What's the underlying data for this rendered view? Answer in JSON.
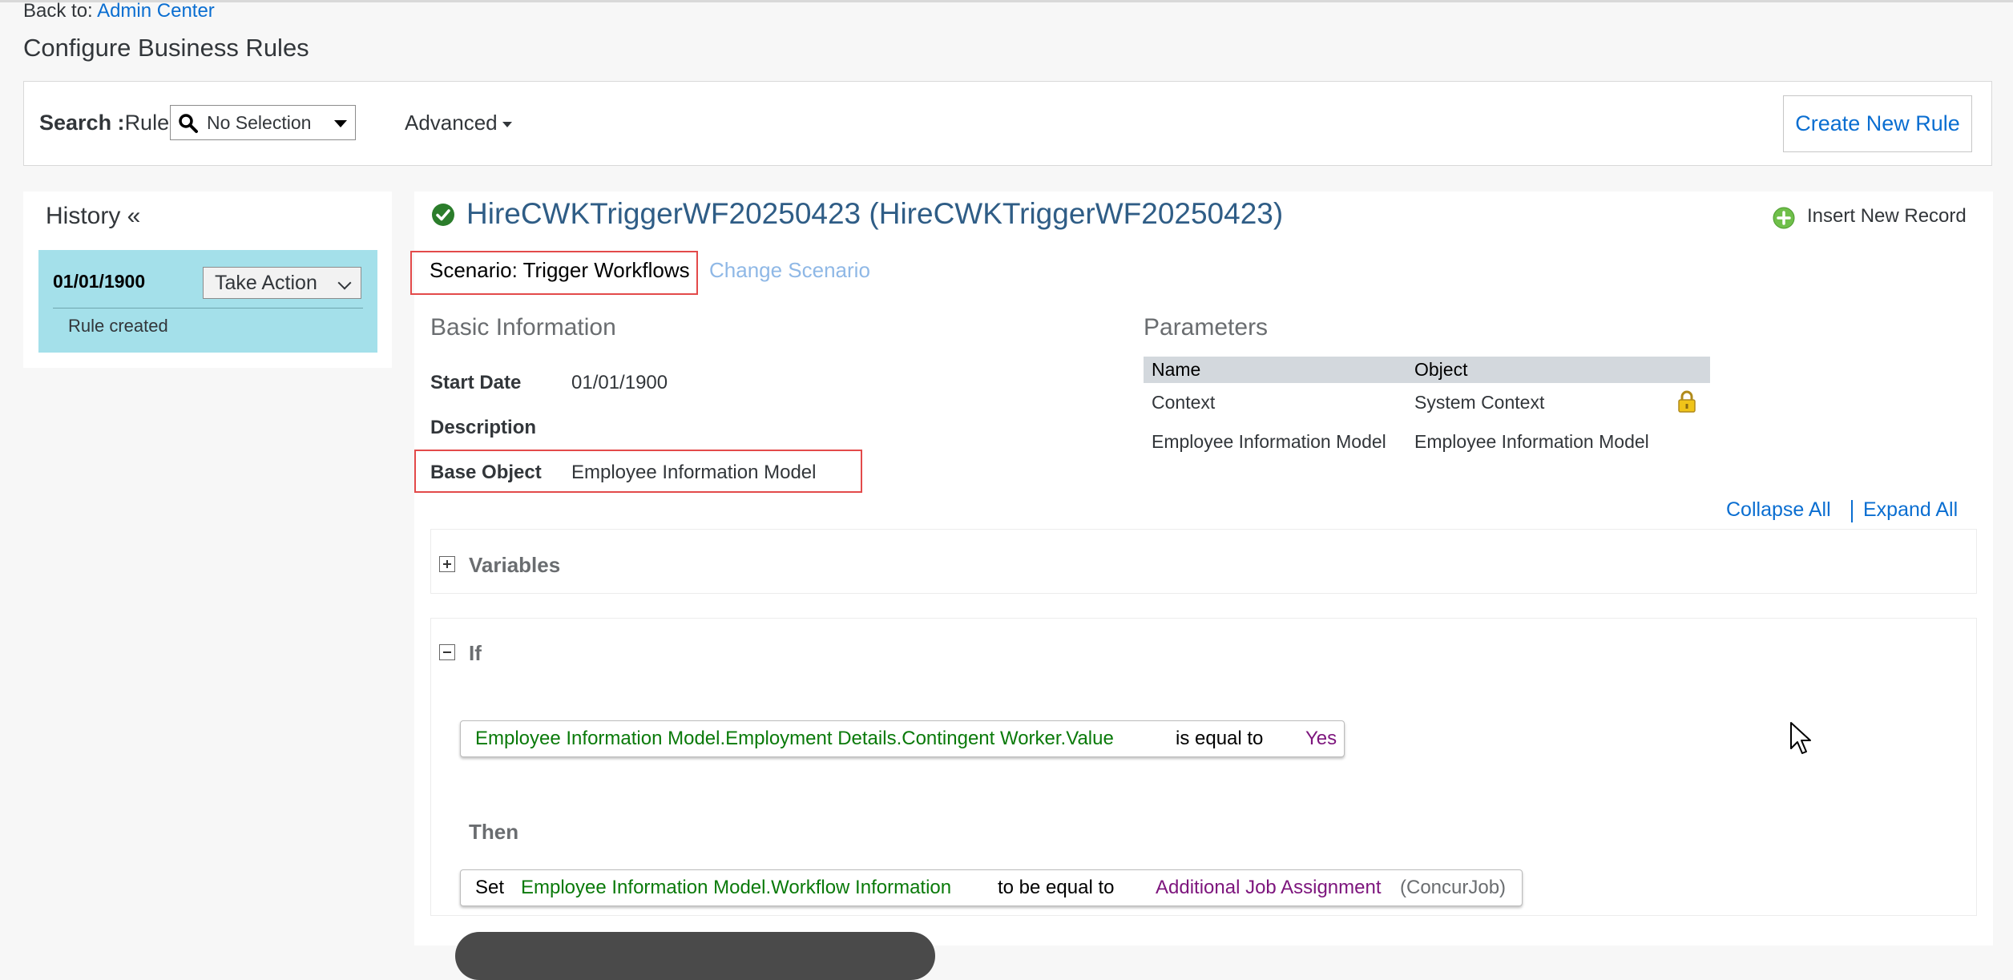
{
  "header": {
    "back_prefix": "Back to:",
    "back_link": "Admin Center",
    "page_title": "Configure Business Rules"
  },
  "search": {
    "label": "Search :",
    "type": "Rule",
    "selection": "No Selection",
    "advanced": "Advanced",
    "create_button": "Create New Rule"
  },
  "history": {
    "title": "History «",
    "entries": [
      {
        "date": "01/01/1900",
        "action": "Take Action",
        "note": "Rule created"
      }
    ]
  },
  "rule": {
    "title": "HireCWKTriggerWF20250423 (HireCWKTriggerWF20250423)",
    "insert_record": "Insert New Record",
    "scenario": "Scenario: Trigger Workflows",
    "change_scenario": "Change Scenario"
  },
  "basic_info": {
    "heading": "Basic Information",
    "start_date_label": "Start Date",
    "start_date": "01/01/1900",
    "description_label": "Description",
    "base_object_label": "Base Object",
    "base_object": "Employee Information Model"
  },
  "parameters": {
    "heading": "Parameters",
    "columns": [
      "Name",
      "Object"
    ],
    "rows": [
      {
        "name": "Context",
        "object": "System Context",
        "locked": true
      },
      {
        "name": "Employee Information Model",
        "object": "Employee Information Model",
        "locked": false
      }
    ]
  },
  "controls": {
    "collapse_all": "Collapse All",
    "expand_all": "Expand All"
  },
  "variables": {
    "label": "Variables",
    "toggle": "+"
  },
  "if_block": {
    "label": "If",
    "toggle": "-",
    "condition_field": "Employee Information Model.Employment Details.Contingent Worker.Value",
    "condition_op": "is equal to",
    "condition_value": "Yes"
  },
  "then_block": {
    "label": "Then",
    "set_label": "Set",
    "target_field": "Employee Information Model.Workflow Information",
    "op": "to be equal to",
    "value": "Additional Job Assignment",
    "value_suffix": "(ConcurJob)"
  },
  "colors": {
    "link": "#0a6ed1",
    "title": "#2f5d86",
    "highlight_box": "#e34a4a",
    "history_card": "#a4e0ea",
    "field_green": "#0a7a0a",
    "value_purple": "#7d157d"
  }
}
